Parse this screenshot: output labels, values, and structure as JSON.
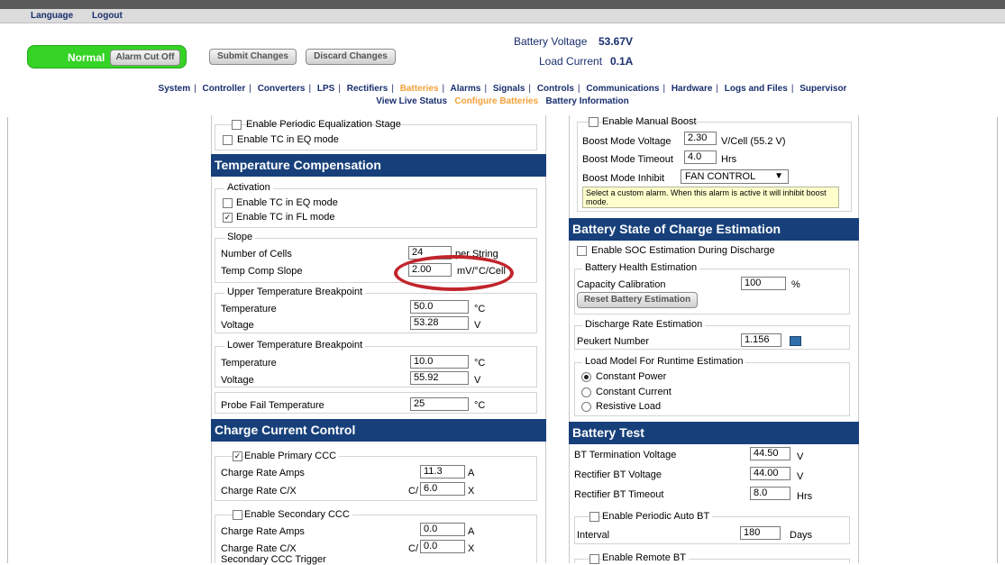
{
  "topbar": {
    "language": "Language",
    "logout": "Logout"
  },
  "status": {
    "label": "Normal",
    "alarm_cut_off": "Alarm Cut Off"
  },
  "actions": {
    "submit": "Submit Changes",
    "discard": "Discard Changes"
  },
  "header": {
    "battery_voltage_label": "Battery Voltage",
    "battery_voltage_value": "53.67V",
    "load_current_label": "Load Current",
    "load_current_value": "0.1A"
  },
  "nav": {
    "items": [
      "System",
      "Controller",
      "Converters",
      "LPS",
      "Rectifiers",
      "Batteries",
      "Alarms",
      "Signals",
      "Controls",
      "Communications",
      "Hardware",
      "Logs and Files",
      "Supervisor"
    ],
    "active": "Batteries",
    "sub_items": [
      "View Live Status",
      "Configure Batteries",
      "Battery Information"
    ],
    "sub_active": "Configure Batteries"
  },
  "left": {
    "eq": {
      "periodic": "Enable Periodic Equalization Stage",
      "tc_eq": "Enable TC in EQ mode"
    },
    "tc": {
      "title": "Temperature Compensation",
      "activation": "Activation",
      "tc_eq": "Enable TC in EQ mode",
      "tc_fl": "Enable TC in FL mode",
      "slope": "Slope",
      "num_cells_label": "Number of Cells",
      "num_cells_value": "24",
      "per_string": "per String",
      "slope_label": "Temp Comp Slope",
      "slope_value": "2.00",
      "slope_unit": "mV/°C/Cell",
      "upper": "Upper Temperature Breakpoint",
      "lower": "Lower Temperature Breakpoint",
      "temperature": "Temperature",
      "voltage": "Voltage",
      "upper_temp": "50.0",
      "upper_volt": "53.28",
      "lower_temp": "10.0",
      "lower_volt": "55.92",
      "unit_c": "°C",
      "unit_v": "V",
      "probe_fail_label": "Probe Fail Temperature",
      "probe_fail_value": "25"
    },
    "ccc": {
      "title": "Charge Current Control",
      "primary": "Enable Primary CCC",
      "rate_amps": "Charge Rate Amps",
      "rate_cx": "Charge Rate C/X",
      "p_amps": "11.3",
      "p_cx": "6.0",
      "unit_a": "A",
      "c_prefix": "C/",
      "x_suffix": "X",
      "secondary": "Enable Secondary CCC",
      "s_amps": "0.0",
      "s_cx": "0.0",
      "trigger": "Secondary CCC Trigger"
    }
  },
  "right": {
    "boost": {
      "manual": "Enable Manual Boost",
      "voltage_label": "Boost Mode Voltage",
      "voltage_value": "2.30",
      "voltage_unit": "V/Cell (55.2 V)",
      "timeout_label": "Boost Mode Timeout",
      "timeout_value": "4.0",
      "timeout_unit": "Hrs",
      "inhibit_label": "Boost Mode Inhibit",
      "inhibit_value": "FAN CONTROL",
      "tip": "Select a custom alarm. When this alarm is active it will inhibit boost mode."
    },
    "soc": {
      "title": "Battery State of Charge Estimation",
      "enable": "Enable SOC Estimation During Discharge",
      "health": "Battery Health Estimation",
      "capacity_label": "Capacity Calibration",
      "capacity_value": "100",
      "capacity_unit": "%",
      "reset": "Reset Battery Estimation",
      "discharge": "Discharge Rate Estimation",
      "peukert_label": "Peukert Number",
      "peukert_value": "1.156",
      "load_model": "Load Model For Runtime Estimation",
      "options": [
        "Constant Power",
        "Constant Current",
        "Resistive Load"
      ],
      "selected": "Constant Power"
    },
    "bt": {
      "title": "Battery Test",
      "term_label": "BT Termination Voltage",
      "term_value": "44.50",
      "rect_v_label": "Rectifier BT Voltage",
      "rect_v_value": "44.00",
      "timeout_label": "Rectifier BT Timeout",
      "timeout_value": "8.0",
      "unit_v": "V",
      "unit_hrs": "Hrs",
      "periodic": "Enable Periodic Auto BT",
      "interval_label": "Interval",
      "interval_value": "180",
      "interval_unit": "Days",
      "remote": "Enable Remote BT"
    }
  }
}
